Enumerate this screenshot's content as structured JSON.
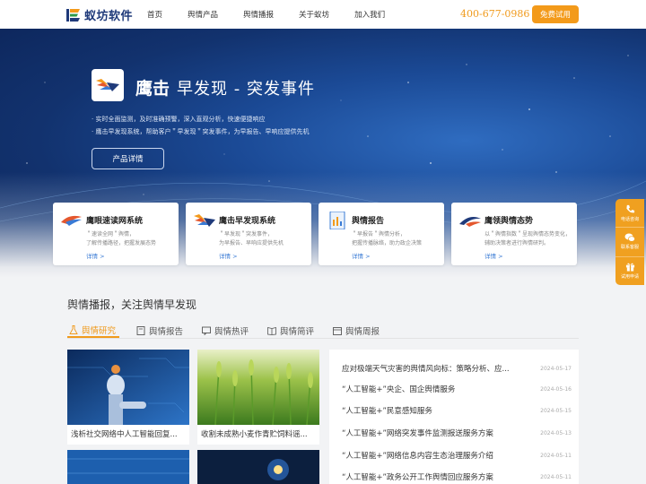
{
  "header": {
    "logo_text": "蚁坊软件",
    "nav": [
      "首页",
      "舆情产品",
      "舆情播报",
      "关于蚁坊",
      "加入我们"
    ],
    "phone": "400-677-0986",
    "trial_button": "免费试用"
  },
  "hero": {
    "title_main": "鹰击",
    "title_sub": "早发现 - 突发事件",
    "bullets": [
      "· 实时全面监测，及时准确预警，深入直观分析，快速便捷响应",
      "· 鹰击早发现系统，帮助客户＂早发现＂突发事件，为早报告、早响应提供先机"
    ],
    "detail_button": "产品详情"
  },
  "cards": [
    {
      "title": "鹰眼速读网系统",
      "desc": [
        "＂速读全网＂舆情，",
        "了解传播路径，把握发展态势"
      ],
      "link": "详情 >",
      "icon": "eagle-eye-icon"
    },
    {
      "title": "鹰击早发现系统",
      "desc": [
        "＂早发现＂突发事件，",
        "为早报告、早响应提供先机"
      ],
      "link": "详情 >",
      "icon": "eagle-strike-icon"
    },
    {
      "title": "舆情报告",
      "desc": [
        "＂早报告＂舆情分析，",
        "把握传播脉络，助力政企决策"
      ],
      "link": "详情 >",
      "icon": "report-icon"
    },
    {
      "title": "鹰领舆情态势",
      "desc": [
        "以＂舆情指数＂呈现舆情态势变化，",
        "辅助决策者进行舆情研判。"
      ],
      "link": "详情 >",
      "icon": "eagle-lead-icon"
    }
  ],
  "side": [
    "电话咨询",
    "联系客服",
    "试用申请"
  ],
  "section": {
    "title": "舆情播报，关注舆情早发现",
    "tabs": [
      "舆情研究",
      "舆情报告",
      "舆情热评",
      "舆情简评",
      "舆情周报"
    ],
    "image_news": [
      "浅析社交网络中人工智能回复...",
      "收割未成熟小麦作青贮饲料谣..."
    ],
    "news": [
      {
        "title": "应对极端天气灾害的舆情风向标：策略分析、应...",
        "date": "2024-05-17"
      },
      {
        "title": "“人工智能+”央企、国企舆情服务",
        "date": "2024-05-16"
      },
      {
        "title": "“人工智能+”民意感知服务",
        "date": "2024-05-15"
      },
      {
        "title": "“人工智能+”网络突发事件监测报送服务方案",
        "date": "2024-05-13"
      },
      {
        "title": "“人工智能+”网络信息内容生态治理服务介绍",
        "date": "2024-05-11"
      },
      {
        "title": "“人工智能+”政务公开工作舆情回应服务方案",
        "date": "2024-05-11"
      }
    ]
  },
  "colors": {
    "accent": "#f39a1a",
    "brand": "#1f3a7a",
    "link": "#3a7bd5"
  }
}
